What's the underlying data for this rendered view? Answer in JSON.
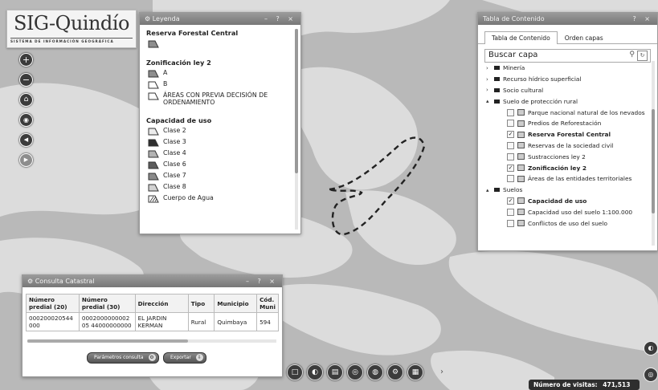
{
  "logo": {
    "main": "SIG-Quindío",
    "sub": "SISTEMA DE INFORMACIÓN GEOGRÁFICA"
  },
  "map_tools": [
    {
      "name": "zoom-in",
      "glyph": "+"
    },
    {
      "name": "zoom-out",
      "glyph": "−"
    },
    {
      "name": "home",
      "glyph": "⌂"
    },
    {
      "name": "location",
      "glyph": "◉"
    },
    {
      "name": "back",
      "glyph": "◀"
    },
    {
      "name": "forward",
      "glyph": "▶"
    }
  ],
  "legend": {
    "title": "Leyenda",
    "controls": "– ? ×",
    "sections": [
      {
        "title": "Reserva Forestal Central",
        "items": [
          {
            "label": "",
            "swatch": "#8e8e8e"
          }
        ]
      },
      {
        "title": "Zonificación ley 2",
        "items": [
          {
            "label": "A",
            "swatch": "#8e8e8e"
          },
          {
            "label": "B",
            "swatch": "#ffffff"
          },
          {
            "label": "ÁREAS CON PREVIA DECISIÓN DE ORDENAMIENTO",
            "swatch": "#ffffff"
          }
        ]
      },
      {
        "title": "Capacidad de uso",
        "items": [
          {
            "label": "Clase 2",
            "swatch": "#ececec"
          },
          {
            "label": "Clase 3",
            "swatch": "#2f2f2f"
          },
          {
            "label": "Clase 4",
            "swatch": "#b3b3b3"
          },
          {
            "label": "Clase 6",
            "swatch": "#5c5c5c"
          },
          {
            "label": "Clase 7",
            "swatch": "#8a8a8a"
          },
          {
            "label": "Clase 8",
            "swatch": "#d2d2d2"
          },
          {
            "label": "Cuerpo de Agua",
            "swatch": "hatch"
          }
        ]
      }
    ]
  },
  "toc": {
    "title": "Tabla de Contenido",
    "controls": "? ×",
    "tabs": [
      "Tabla de Contenido",
      "Orden capas"
    ],
    "search_placeholder": "Buscar capa",
    "nodes": [
      {
        "level": 1,
        "type": "folder",
        "label": "Minería",
        "expanded": false
      },
      {
        "level": 1,
        "type": "folder",
        "label": "Recurso hídrico superficial",
        "expanded": false
      },
      {
        "level": 1,
        "type": "folder",
        "label": "Socio cultural",
        "expanded": false
      },
      {
        "level": 1,
        "type": "folder",
        "label": "Suelo de protección rural",
        "expanded": true
      },
      {
        "level": 2,
        "type": "layer",
        "label": "Parque nacional natural de los nevados",
        "checked": false
      },
      {
        "level": 2,
        "type": "layer",
        "label": "Predios de Reforestación",
        "checked": false
      },
      {
        "level": 2,
        "type": "layer",
        "label": "Reserva Forestal Central",
        "checked": true
      },
      {
        "level": 2,
        "type": "layer",
        "label": "Reservas de la sociedad civil",
        "checked": false
      },
      {
        "level": 2,
        "type": "layer",
        "label": "Sustracciones ley 2",
        "checked": false
      },
      {
        "level": 2,
        "type": "layer",
        "label": "Zonificación ley 2",
        "checked": true
      },
      {
        "level": 2,
        "type": "layer",
        "label": "Áreas de las entidades territoriales",
        "checked": false
      },
      {
        "level": 1,
        "type": "folder",
        "label": "Suelos",
        "expanded": true
      },
      {
        "level": 2,
        "type": "layer",
        "label": "Capacidad de uso",
        "checked": true
      },
      {
        "level": 2,
        "type": "layer",
        "label": "Capacidad uso del suelo 1:100.000",
        "checked": false
      },
      {
        "level": 2,
        "type": "layer",
        "label": "Conflictos de uso del suelo",
        "checked": false
      }
    ]
  },
  "catastro": {
    "title": "Consulta Catastral",
    "controls": "– ? ×",
    "headers": [
      "Número predial (20)",
      "Número predial (30)",
      "Dirección",
      "Tipo",
      "Municipio",
      "Cód. Muni"
    ],
    "rows": [
      [
        "000200020544000",
        "000200000000205 44000000000",
        "EL JARDIN KERMAN",
        "Rural",
        "Quimbaya",
        "594"
      ]
    ],
    "buttons": [
      "Parámetros consulta",
      "Exportar"
    ]
  },
  "footer": {
    "visits_label": "Número de visitas:",
    "visits_value": "471,513",
    "arrow": "›"
  },
  "bottom_tools": [
    "□",
    "◐",
    "▤",
    "◎",
    "◍",
    "⚙",
    "▦"
  ]
}
